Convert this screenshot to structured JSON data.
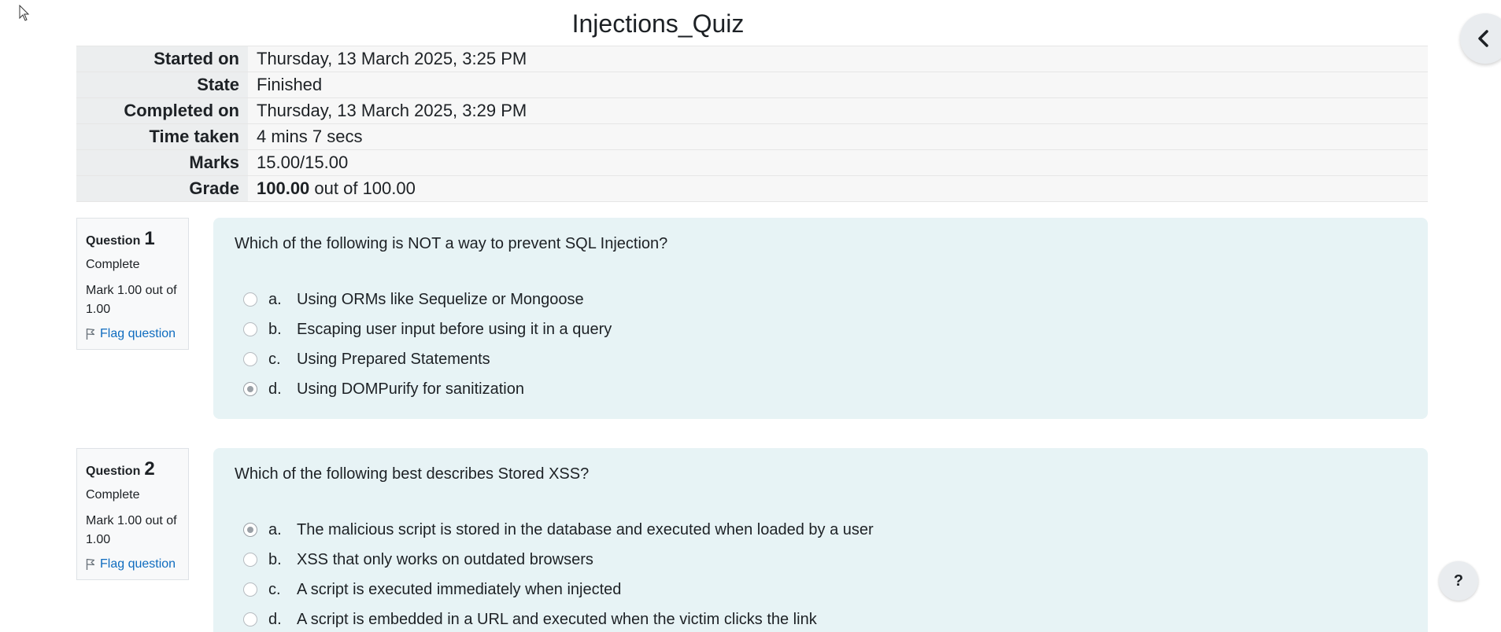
{
  "page": {
    "title": "Injections_Quiz"
  },
  "summary": {
    "rows": [
      {
        "label": "Started on",
        "value": "Thursday, 13 March 2025, 3:25 PM"
      },
      {
        "label": "State",
        "value": "Finished"
      },
      {
        "label": "Completed on",
        "value": "Thursday, 13 March 2025, 3:29 PM"
      },
      {
        "label": "Time taken",
        "value": "4 mins 7 secs"
      },
      {
        "label": "Marks",
        "value": "15.00/15.00"
      }
    ],
    "grade": {
      "label": "Grade",
      "score": "100.00",
      "suffix": " out of 100.00"
    }
  },
  "questions": [
    {
      "label": "Question",
      "number": "1",
      "state": "Complete",
      "grade": "Mark 1.00 out of 1.00",
      "flag": "Flag question",
      "text": "Which of the following is NOT a way to prevent SQL Injection?",
      "answers": [
        {
          "letter": "a.",
          "text": "Using ORMs like Sequelize or Mongoose",
          "selected": false
        },
        {
          "letter": "b.",
          "text": "Escaping user input before using it in a query",
          "selected": false
        },
        {
          "letter": "c.",
          "text": "Using Prepared Statements",
          "selected": false
        },
        {
          "letter": "d.",
          "text": "Using DOMPurify for sanitization",
          "selected": true
        }
      ]
    },
    {
      "label": "Question",
      "number": "2",
      "state": "Complete",
      "grade": "Mark 1.00 out of 1.00",
      "flag": "Flag question",
      "text": "Which of the following best describes Stored XSS?",
      "answers": [
        {
          "letter": "a.",
          "text": "The malicious script is stored in the database and executed when loaded by a user",
          "selected": true
        },
        {
          "letter": "b.",
          "text": "XSS that only works on outdated browsers",
          "selected": false
        },
        {
          "letter": "c.",
          "text": "A script is executed immediately when injected",
          "selected": false
        },
        {
          "letter": "d.",
          "text": "A script is embedded in a URL and executed when the victim clicks the link",
          "selected": false
        }
      ]
    }
  ],
  "help": {
    "label": "?"
  },
  "icons": {
    "cursor": "mouse-pointer-icon",
    "drawer": "chevron-left-icon",
    "flag": "flag-icon",
    "help": "question-mark-icon"
  }
}
